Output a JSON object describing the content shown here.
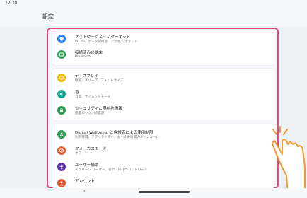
{
  "status_bar": {
    "time": "12:30"
  },
  "app_bar": {
    "title": "設定"
  },
  "groups": [
    {
      "items": [
        {
          "label": "ネットワークとインターネット",
          "sub": "WLAN、データ使用量、アクセス ポイント",
          "icon": "wifi-icon",
          "color": "#2f80ed"
        },
        {
          "label": "接続済みの端末",
          "sub": "Bluetooth",
          "icon": "devices-icon",
          "color": "#2e9e4f"
        }
      ]
    },
    {
      "items": [
        {
          "label": "ディスプレイ",
          "sub": "壁紙、スリープ、フォントサイズ",
          "icon": "display-icon",
          "color": "#f2b705"
        },
        {
          "label": "音",
          "sub": "音量、サイレントモード",
          "icon": "sound-icon",
          "color": "#16a99a"
        },
        {
          "label": "セキュリティと現在地情報",
          "sub": "画面ロック、顔認証",
          "icon": "lock-icon",
          "color": "#2e9e4f"
        }
      ]
    },
    {
      "items": [
        {
          "label": "Digital Wellbeing と保護者による使用制限",
          "sub": "利用時間、アプリタイマー、おやすみ時間のスケジュール",
          "icon": "wellbeing-icon",
          "color": "#2e9e4f"
        },
        {
          "label": "フォーカスモード",
          "sub": "オフ",
          "icon": "focus-icon",
          "color": "#e8562c"
        },
        {
          "label": "ユーザー補助",
          "sub": "スクリーン リーダー、表示、操作のコントロール",
          "icon": "accessibility-icon",
          "color": "#5b2ea8"
        },
        {
          "label": "アカウント",
          "sub": "",
          "icon": "account-icon",
          "color": "#e8562c"
        }
      ]
    }
  ],
  "nav": {
    "back": "‹"
  },
  "colors": {
    "highlight": "#e8467c",
    "background": "#eef1f5"
  }
}
